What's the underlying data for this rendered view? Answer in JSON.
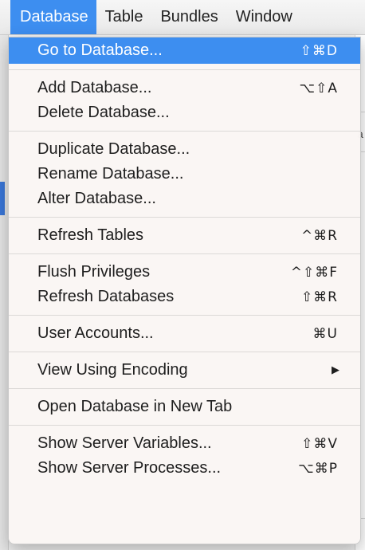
{
  "menubar": {
    "items": [
      {
        "label": "Database",
        "active": true
      },
      {
        "label": "Table",
        "active": false
      },
      {
        "label": "Bundles",
        "active": false
      },
      {
        "label": "Window",
        "active": false
      }
    ]
  },
  "menu": {
    "groups": [
      [
        {
          "label": "Go to Database...",
          "shortcut": "⇧⌘D",
          "highlighted": true
        }
      ],
      [
        {
          "label": "Add Database...",
          "shortcut": "⌥⇧A"
        },
        {
          "label": "Delete Database...",
          "shortcut": ""
        }
      ],
      [
        {
          "label": "Duplicate Database...",
          "shortcut": ""
        },
        {
          "label": "Rename Database...",
          "shortcut": ""
        },
        {
          "label": "Alter Database...",
          "shortcut": ""
        }
      ],
      [
        {
          "label": "Refresh Tables",
          "shortcut": "^⌘R"
        }
      ],
      [
        {
          "label": "Flush Privileges",
          "shortcut": "^⇧⌘F"
        },
        {
          "label": "Refresh Databases",
          "shortcut": "⇧⌘R"
        }
      ],
      [
        {
          "label": "User Accounts...",
          "shortcut": "⌘U"
        }
      ],
      [
        {
          "label": "View Using Encoding",
          "shortcut": "▶",
          "submenu": true
        }
      ],
      [
        {
          "label": "Open Database in New Tab",
          "shortcut": ""
        }
      ],
      [
        {
          "label": "Show Server Variables...",
          "shortcut": "⇧⌘V"
        },
        {
          "label": "Show Server Processes...",
          "shortcut": "⌥⌘P"
        }
      ]
    ]
  },
  "background": {
    "edge_glyph": "a"
  },
  "colors": {
    "accent": "#3d8ef0",
    "menu_background": "#faf6f4",
    "text": "#1e1e1e"
  }
}
